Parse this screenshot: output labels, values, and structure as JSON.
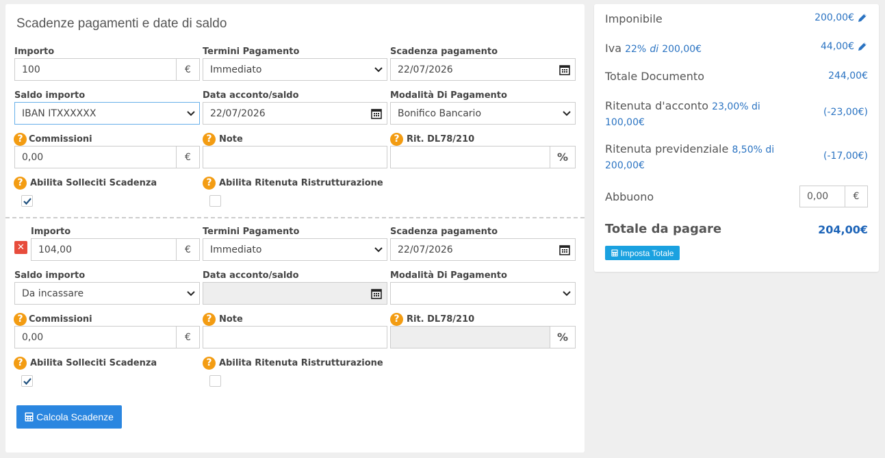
{
  "panel": {
    "title": "Scadenze pagamenti e date di saldo"
  },
  "labels": {
    "importo": "Importo",
    "termini": "Termini Pagamento",
    "scadenza": "Scadenza pagamento",
    "saldo": "Saldo importo",
    "data_acconto": "Data acconto/saldo",
    "modalita": "Modalità Di Pagamento",
    "commissioni": "Commissioni",
    "note": "Note",
    "rit": "Rit. DL78/210",
    "solleciti": "Abilita Solleciti Scadenza",
    "ritenuta_ristr": "Abilita Ritenuta Ristrutturazione"
  },
  "icons": {
    "help": "question-circle-icon",
    "calendar": "calendar-icon",
    "calculator": "calculator-icon",
    "pencil": "pencil-icon",
    "remove": "remove-icon"
  },
  "currency": "€",
  "percent": "%",
  "help_glyph": "?",
  "remove_glyph": "✕",
  "installments": [
    {
      "importo": "100",
      "termini": "Immediato",
      "scadenza": "22/07/2026",
      "saldo": "IBAN ITXXXXXX",
      "data_acconto": "22/07/2026",
      "modalita": "Bonifico Bancario",
      "commissioni": "0,00",
      "note": "",
      "rit": "",
      "solleciti_checked": true,
      "ritenuta_checked": false
    },
    {
      "importo": "104,00",
      "termini": "Immediato",
      "scadenza": "22/07/2026",
      "saldo": "Da incassare",
      "data_acconto": "",
      "modalita": "",
      "commissioni": "0,00",
      "note": "",
      "rit": "",
      "solleciti_checked": true,
      "ritenuta_checked": false
    }
  ],
  "calcola_button": "Calcola Scadenze",
  "summary": {
    "imponibile_label": "Imponibile",
    "imponibile_value": "200,00€",
    "iva_label": "Iva",
    "iva_detail_rate": "22%",
    "iva_detail_of": "di",
    "iva_detail_base": "200,00€",
    "iva_value": "44,00€",
    "totale_doc_label": "Totale Documento",
    "totale_doc_value": "244,00€",
    "ritenuta_acconto_label": "Ritenuta d'acconto",
    "ritenuta_acconto_detail1": "23,00% di",
    "ritenuta_acconto_detail2": "100,00€",
    "ritenuta_acconto_value": "(-23,00€)",
    "ritenuta_prev_label": "Ritenuta previdenziale",
    "ritenuta_prev_detail1": "8,50% di",
    "ritenuta_prev_detail2": "200,00€",
    "ritenuta_prev_value": "(-17,00€)",
    "abbuono_label": "Abbuono",
    "abbuono_value": "0,00",
    "totale_pagare_label": "Totale da pagare",
    "totale_pagare_value": "204,00€",
    "imposta_button": "Imposta Totale"
  },
  "colors": {
    "accent": "#2a86e0",
    "help": "#f39c12",
    "remove": "#e74c3c",
    "link": "#2a73c2"
  }
}
